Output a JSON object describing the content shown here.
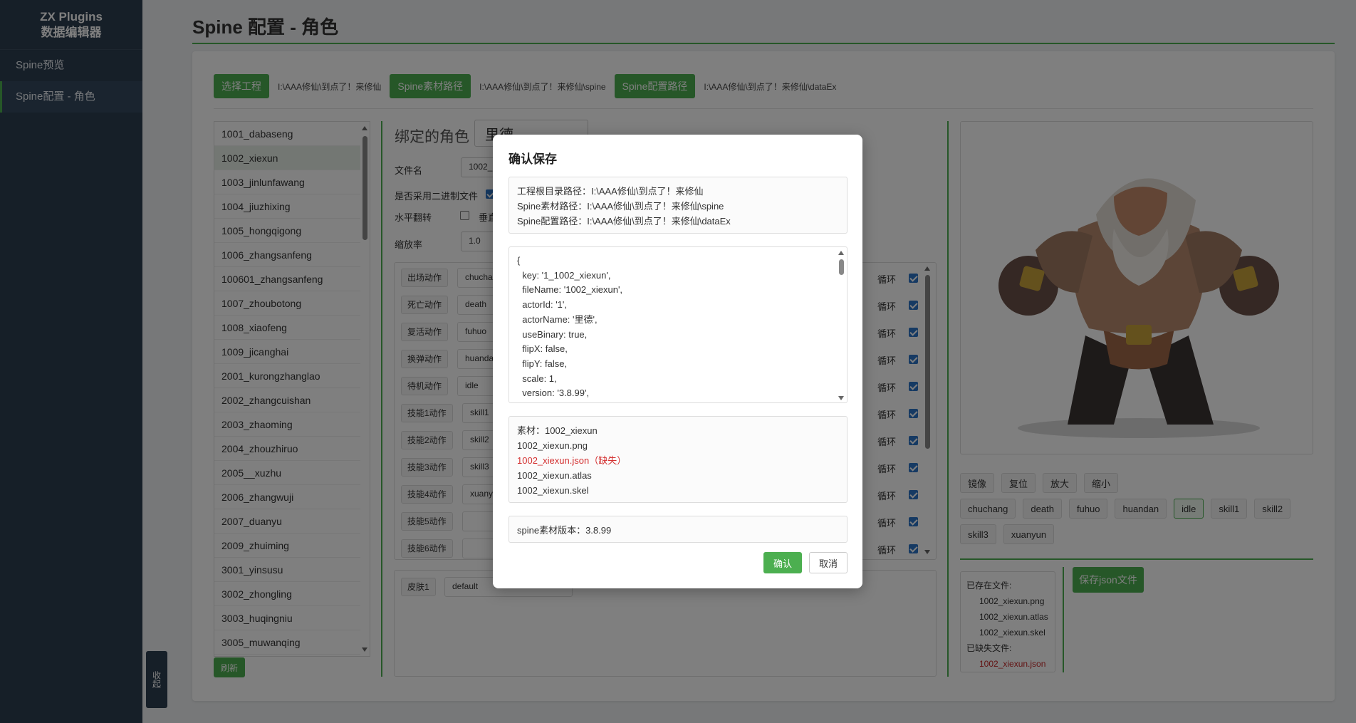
{
  "sidebar": {
    "brand_line1": "ZX Plugins",
    "brand_line2": "数据编辑器",
    "items": [
      {
        "label": "Spine预览"
      },
      {
        "label": "Spine配置 - 角色"
      }
    ],
    "collapse_label": "收起"
  },
  "page": {
    "title": "Spine 配置 - 角色"
  },
  "paths": {
    "select_project_label": "选择工程",
    "project_path": "I:\\AAA修仙\\到点了！来修仙",
    "spine_asset_label": "Spine素材路径",
    "spine_asset_path": "I:\\AAA修仙\\到点了！来修仙\\spine",
    "spine_config_label": "Spine配置路径",
    "spine_config_path": "I:\\AAA修仙\\到点了！来修仙\\dataEx"
  },
  "characters": [
    "1001_dabaseng",
    "1002_xiexun",
    "1003_jinlunfawang",
    "1004_jiuzhixing",
    "1005_hongqigong",
    "1006_zhangsanfeng",
    "100601_zhangsanfeng",
    "1007_zhoubotong",
    "1008_xiaofeng",
    "1009_jicanghai",
    "2001_kurongzhanglao",
    "2002_zhangcuishan",
    "2003_zhaoming",
    "2004_zhouzhiruo",
    "2005__xuzhu",
    "2006_zhangwuji",
    "2007_duanyu",
    "2009_zhuiming",
    "3001_yinsusu",
    "3002_zhongling",
    "3003_huqingniu",
    "3005_muwanqing"
  ],
  "refresh_label": "刷新",
  "config": {
    "bound_role_label": "绑定的角色",
    "bound_role_value": "里德",
    "file_name_label": "文件名",
    "file_name_value": "1002_",
    "use_binary_label": "是否采用二进制文件",
    "flip_h_label": "水平翻转",
    "flip_v_label": "垂直",
    "scale_label": "缩放率",
    "scale_value": "1.0",
    "loop_label": "循环",
    "actions": [
      {
        "label": "出场动作",
        "value": "chucha"
      },
      {
        "label": "死亡动作",
        "value": "death"
      },
      {
        "label": "复活动作",
        "value": "fuhuo"
      },
      {
        "label": "换弹动作",
        "value": "huanda"
      },
      {
        "label": "待机动作",
        "value": "idle"
      },
      {
        "label": "技能1动作",
        "value": "skill1"
      },
      {
        "label": "技能2动作",
        "value": "skill2"
      },
      {
        "label": "技能3动作",
        "value": "skill3"
      },
      {
        "label": "技能4动作",
        "value": "xuany"
      },
      {
        "label": "技能5动作",
        "value": ""
      },
      {
        "label": "技能6动作",
        "value": ""
      }
    ],
    "skin_label": "皮肤1",
    "skin_value": "default"
  },
  "preview": {
    "controls": [
      "镜像",
      "复位",
      "放大",
      "缩小"
    ],
    "anims": [
      "chuchang",
      "death",
      "fuhuo",
      "huandan",
      "idle",
      "skill1",
      "skill2",
      "skill3",
      "xuanyun"
    ],
    "active_anim": "idle",
    "existing_label": "已存在文件:",
    "existing_files": [
      "1002_xiexun.png",
      "1002_xiexun.atlas",
      "1002_xiexun.skel"
    ],
    "missing_label": "已缺失文件:",
    "missing_files": [
      "1002_xiexun.json"
    ],
    "save_json_label": "保存json文件"
  },
  "modal": {
    "title": "确认保存",
    "paths": [
      "工程根目录路径：I:\\AAA修仙\\到点了！来修仙",
      "Spine素材路径：I:\\AAA修仙\\到点了！来修仙\\spine",
      "Spine配置路径：I:\\AAA修仙\\到点了！来修仙\\dataEx"
    ],
    "json_lines": [
      "{",
      "  key: '1_1002_xiexun',",
      "  fileName: '1002_xiexun',",
      "  actorId: '1',",
      "  actorName: '里德',",
      "  useBinary: true,",
      "  flipX: false,",
      "  flipY: false,",
      "  scale: 1,",
      "  version: '3.8.99',"
    ],
    "asset_title": "素材：1002_xiexun",
    "asset_files": [
      {
        "name": "1002_xiexun.png",
        "missing": false
      },
      {
        "name": "1002_xiexun.json（缺失）",
        "missing": true
      },
      {
        "name": "1002_xiexun.atlas",
        "missing": false
      },
      {
        "name": "1002_xiexun.skel",
        "missing": false
      }
    ],
    "version_text": "spine素材版本：3.8.99",
    "confirm_label": "确认",
    "cancel_label": "取消"
  },
  "colors": {
    "accent": "#4caf50",
    "sidebar_bg": "#2c3e50",
    "missing": "#d32f2f"
  }
}
